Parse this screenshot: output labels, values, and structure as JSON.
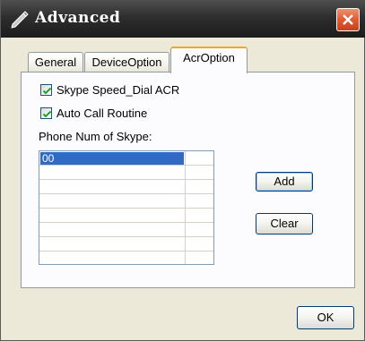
{
  "window": {
    "title": "Advanced"
  },
  "tabs": [
    {
      "label": "General",
      "active": false
    },
    {
      "label": "DeviceOption",
      "active": false
    },
    {
      "label": "AcrOption",
      "active": true
    }
  ],
  "acr_option": {
    "checkboxes": [
      {
        "label": "Skype Speed_Dial ACR",
        "checked": true
      },
      {
        "label": "Auto Call Routine",
        "checked": true
      }
    ],
    "phone_label": "Phone Num of Skype:",
    "phone_list": {
      "rows": [
        "00",
        "",
        "",
        "",
        "",
        "",
        "",
        ""
      ],
      "selected_index": 0
    },
    "add_label": "Add",
    "clear_label": "Clear"
  },
  "footer": {
    "ok_label": "OK"
  },
  "icons": {
    "title_icon": "pencil-icon",
    "close_icon": "close-icon",
    "check_icon": "checkmark-icon"
  },
  "colors": {
    "titlebar": "#2e2e2e",
    "close_button": "#e05a32",
    "active_tab_accent": "#f5a623",
    "selection": "#316ac5",
    "dialog_bg": "#ece9d8",
    "checkmark": "#21a121"
  }
}
